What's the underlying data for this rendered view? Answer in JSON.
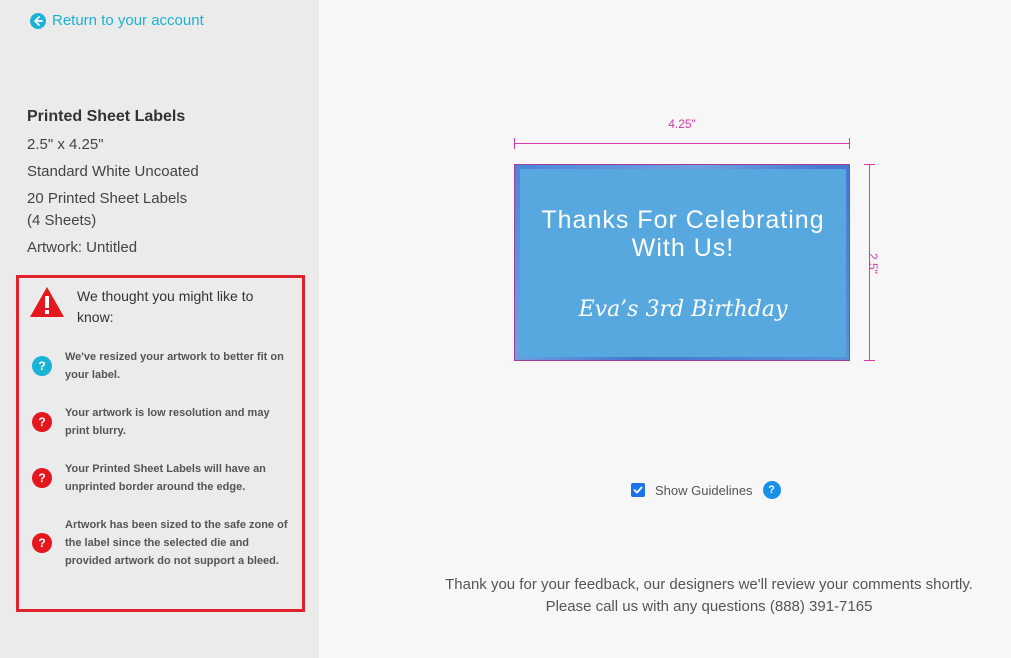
{
  "sidebar": {
    "return_link": "Return to your account",
    "product": {
      "title": "Printed Sheet Labels",
      "size": "2.5\" x 4.25\"",
      "material": "Standard White Uncoated",
      "quantity_line1": "20 Printed Sheet Labels",
      "quantity_line2": "(4 Sheets)",
      "artwork": "Artwork: Untitled"
    },
    "notice": {
      "heading": "We thought you might like to know:",
      "items": [
        {
          "icon": "info",
          "text": "We've resized your artwork to better fit on your label."
        },
        {
          "icon": "error",
          "text": "Your artwork is low resolution and may print blurry."
        },
        {
          "icon": "error",
          "text": "Your Printed Sheet Labels will have an unprinted border around the edge."
        },
        {
          "icon": "error",
          "text": "Artwork has been sized to the safe zone of the label since the selected die and provided artwork do not support a bleed."
        }
      ]
    }
  },
  "preview": {
    "width_label": "4.25\"",
    "height_label": "2.5\"",
    "label_text_line1": "Thanks For Celebrating With Us!",
    "label_text_line2": "Eva’s 3rd Birthday"
  },
  "guidelines": {
    "label": "Show Guidelines",
    "checked": true,
    "help_glyph": "?"
  },
  "feedback": {
    "line1": "Thank you for your feedback, our designers we'll review your comments shortly.",
    "line2": "Please call us with any questions (888) 391-7165"
  },
  "colors": {
    "accent": "#1ab3d6",
    "error": "#e6161f",
    "dimension": "#d63ba8",
    "notice_border": "#e0222b"
  }
}
